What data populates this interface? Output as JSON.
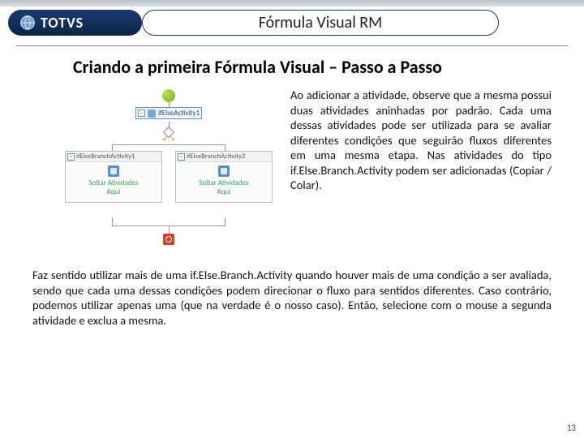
{
  "brand": {
    "name": "TOTVS"
  },
  "header": {
    "title": "Fórmula Visual RM"
  },
  "section": {
    "heading": "Criando a primeira Fórmula Visual – Passo a Passo"
  },
  "diagram": {
    "ifelse_label": "ifElseActivity1",
    "branch_left": {
      "title": "ifElseBranchActivity1",
      "drop_line1": "Soltar Atividades",
      "drop_line2": "Aqui"
    },
    "branch_right": {
      "title": "ifElseBranchActivity2",
      "drop_line1": "Soltar Atividades",
      "drop_line2": "Aqui"
    }
  },
  "body": {
    "para1": "Ao adicionar a atividade, observe que a mesma possui duas atividades aninhadas por padrão. Cada uma dessas atividades pode ser utilizada para se avaliar diferentes condições que seguirão fluxos diferentes em uma mesma etapa. Nas atividades do tipo if.Else.Branch.Activity podem ser adicionadas (Copiar / Colar).",
    "para2": "Faz sentido utilizar mais de uma if.Else.Branch.Activity quando houver mais de uma condição a ser avaliada, sendo que cada uma dessas condições podem direcionar o fluxo para sentidos diferentes. Caso contrário, podemos utilizar apenas uma (que na verdade é o nosso caso). Então, selecione com o mouse a segunda atividade e exclua a mesma."
  },
  "page": {
    "number": "13"
  }
}
